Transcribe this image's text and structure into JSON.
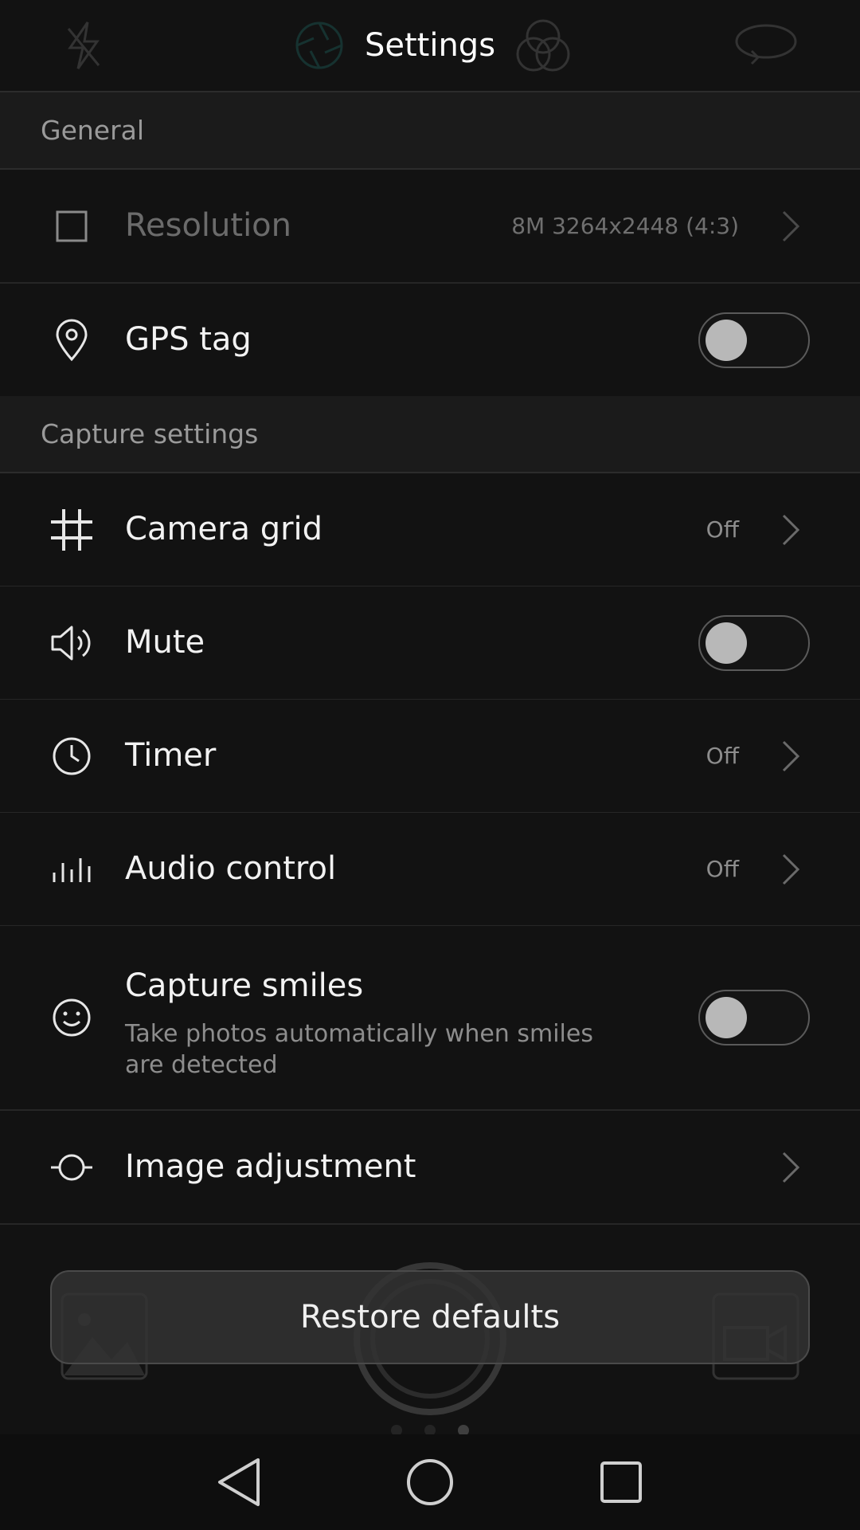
{
  "header": {
    "title": "Settings"
  },
  "sections": {
    "general": "General",
    "capture": "Capture settings"
  },
  "rows": {
    "resolution": {
      "label": "Resolution",
      "value": "8M 3264x2448 (4:3)",
      "enabled": false
    },
    "gps": {
      "label": "GPS tag",
      "on": false
    },
    "grid": {
      "label": "Camera grid",
      "value": "Off"
    },
    "mute": {
      "label": "Mute",
      "on": false
    },
    "timer": {
      "label": "Timer",
      "value": "Off"
    },
    "audio": {
      "label": "Audio control",
      "value": "Off"
    },
    "smiles": {
      "label": "Capture smiles",
      "sub": "Take photos automatically when smiles are detected",
      "on": false
    },
    "adjust": {
      "label": "Image adjustment"
    }
  },
  "restore": {
    "label": "Restore defaults"
  },
  "icons": {
    "resolution": "square-outline-icon",
    "gps": "location-pin-icon",
    "grid": "grid-icon",
    "mute": "speaker-icon",
    "timer": "clock-icon",
    "audio": "audio-bars-icon",
    "smiles": "smiley-icon",
    "adjust": "adjustment-icon"
  },
  "colors": {
    "background": "#121212",
    "section": "#1b1b1b",
    "text": "#f2f2f2",
    "muted": "#8d8d8d"
  }
}
